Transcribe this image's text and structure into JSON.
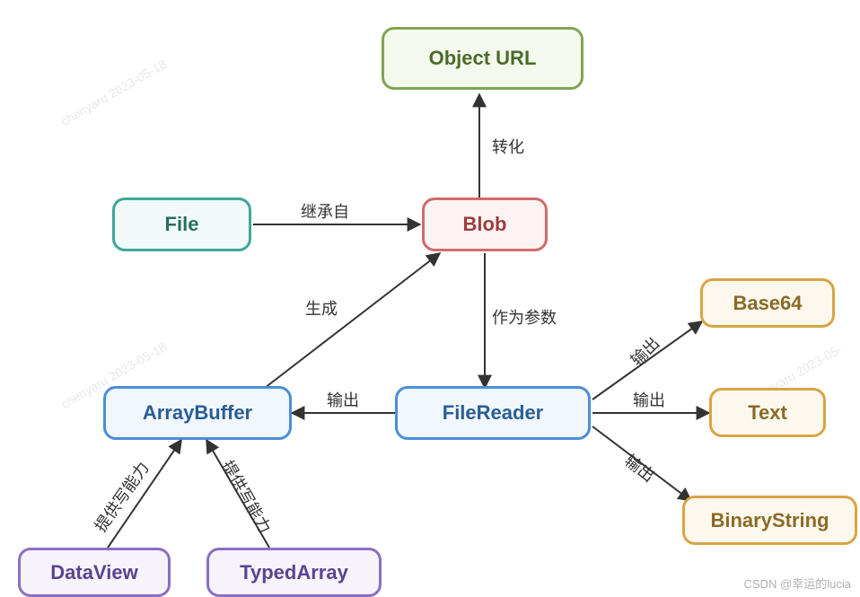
{
  "nodes": {
    "object_url": {
      "label": "Object URL"
    },
    "file": {
      "label": "File"
    },
    "blob": {
      "label": "Blob"
    },
    "arraybuffer": {
      "label": "ArrayBuffer"
    },
    "filereader": {
      "label": "FileReader"
    },
    "base64": {
      "label": "Base64"
    },
    "text": {
      "label": "Text"
    },
    "binarystring": {
      "label": "BinaryString"
    },
    "dataview": {
      "label": "DataView"
    },
    "typedarray": {
      "label": "TypedArray"
    }
  },
  "edges": {
    "blob_to_objecturl": {
      "label": "转化"
    },
    "file_to_blob": {
      "label": "继承自"
    },
    "arraybuffer_to_blob": {
      "label": "生成"
    },
    "blob_to_filereader": {
      "label": "作为参数"
    },
    "filereader_to_arraybuffer": {
      "label": "输出"
    },
    "filereader_to_base64": {
      "label": "输出"
    },
    "filereader_to_text": {
      "label": "输出"
    },
    "filereader_to_binary": {
      "label": "输出"
    },
    "dataview_to_ab": {
      "label": "提供写能力"
    },
    "typedarray_to_ab": {
      "label": "提供写能力"
    }
  },
  "watermark": {
    "text": "chenyaru 2023-05-18"
  },
  "credit": {
    "text": "CSDN @幸运的lucia"
  }
}
